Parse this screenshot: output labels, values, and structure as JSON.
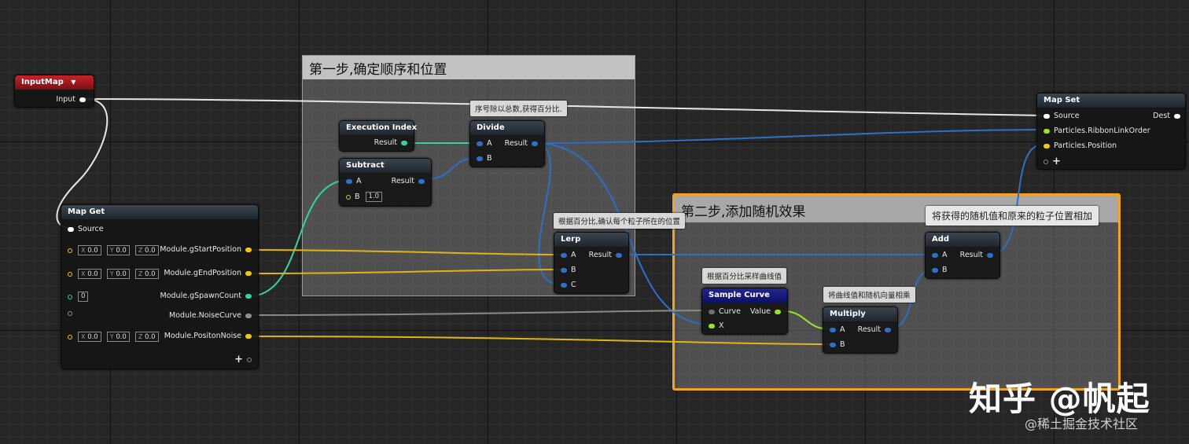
{
  "graph": {
    "comments": {
      "step1": "第一步,确定顺序和位置",
      "step2": "第二步,添加随机效果"
    },
    "tooltips": {
      "divide": "序号除以总数,获得百分比.",
      "lerp": "根据百分比,确认每个粒子所在的位置",
      "sample_curve": "根据百分比采样曲线值",
      "multiply": "将曲线值和随机向量相乘",
      "add": "将获得的随机值和原来的粒子位置相加"
    },
    "nodes": {
      "input_map": {
        "title": "InputMap",
        "dropdown_icon": "triangle-down",
        "pin_input": "Input"
      },
      "map_get": {
        "title": "Map Get",
        "pin_source": "Source",
        "outputs": [
          "Module.gStartPosition",
          "Module.gEndPosition",
          "Module.gSpawnCount",
          "Module.NoiseCurve",
          "Module.PositonNoise"
        ],
        "vec_labels": [
          "X",
          "Y",
          "Z"
        ],
        "vec_value": "0.0",
        "spawn_count_value": "0",
        "add_pin": "+"
      },
      "execution_index": {
        "title": "Execution Index",
        "out": "Result"
      },
      "subtract": {
        "title": "Subtract",
        "in_a": "A",
        "in_b": "B",
        "b_value": "1.0",
        "out": "Result"
      },
      "divide": {
        "title": "Divide",
        "in_a": "A",
        "in_b": "B",
        "out": "Result"
      },
      "lerp": {
        "title": "Lerp",
        "in_a": "A",
        "in_b": "B",
        "in_c": "C",
        "out": "Result"
      },
      "sample_curve": {
        "title": "Sample Curve",
        "in_curve": "Curve",
        "in_x": "X",
        "out": "Value"
      },
      "multiply": {
        "title": "Multiply",
        "in_a": "A",
        "in_b": "B",
        "out": "Result"
      },
      "add": {
        "title": "Add",
        "in_a": "A",
        "in_b": "B",
        "out": "Result"
      },
      "map_set": {
        "title": "Map Set",
        "pin_source": "Source",
        "pin_dest": "Dest",
        "pins": [
          "Particles.RibbonLinkOrder",
          "Particles.Position"
        ],
        "add_pin": "+"
      }
    },
    "colors": {
      "vector_pin": "#f5c518",
      "float_pin": "#3c8ef0",
      "int_pin": "#37d39b",
      "bool_pin": "#9ae22a",
      "exec_pin": "#ffffff",
      "curve_pin": "#909090",
      "comment_highlight": "#f2a321"
    }
  },
  "watermark": {
    "main": "知乎 @帆起",
    "sub": "@稀土掘金技术社区"
  }
}
